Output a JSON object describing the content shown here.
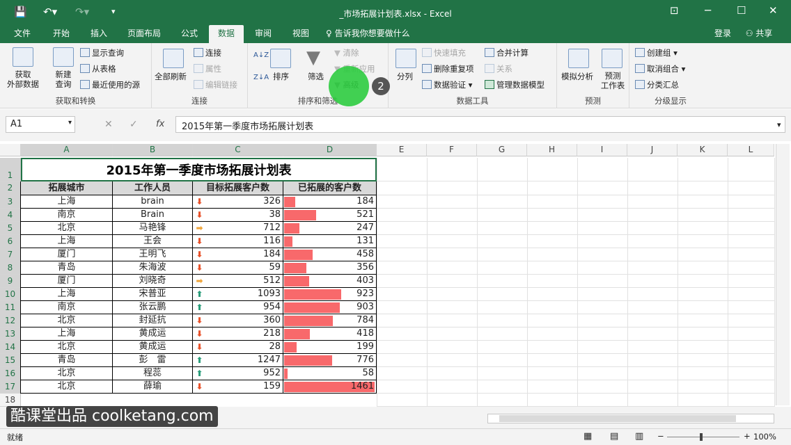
{
  "window": {
    "title": "_市场拓展计划表.xlsx - Excel"
  },
  "tabs": [
    "文件",
    "开始",
    "插入",
    "页面布局",
    "公式",
    "数据",
    "审阅",
    "视图"
  ],
  "tell_me": "告诉我你想要做什么",
  "account": {
    "login": "登录",
    "share": "共享"
  },
  "ribbon": {
    "get_transform": {
      "label": "获取和转换",
      "get_data": "获取\n外部数据",
      "new_query": "新建\n查询",
      "show_queries": "显示查询",
      "from_table": "从表格",
      "recent_sources": "最近使用的源"
    },
    "connections": {
      "label": "连接",
      "refresh_all": "全部刷新",
      "connections": "连接",
      "properties": "属性",
      "edit_links": "编辑链接"
    },
    "sort_filter": {
      "label": "排序和筛选",
      "sort": "排序",
      "filter": "筛选",
      "clear": "清除",
      "reapply": "重新应用",
      "advanced": "高级"
    },
    "data_tools": {
      "label": "数据工具",
      "split": "分列",
      "flash_fill": "快速填充",
      "remove_dup": "删除重复项",
      "validation": "数据验证",
      "consolidate": "合并计算",
      "relations": "关系",
      "data_model": "管理数据模型"
    },
    "forecast": {
      "label": "预测",
      "what_if": "模拟分析",
      "forecast_sheet": "预测\n工作表"
    },
    "outline": {
      "label": "分级显示",
      "group": "创建组",
      "ungroup": "取消组合",
      "subtotal": "分类汇总"
    }
  },
  "formula_bar": {
    "name_box": "A1",
    "content": "2015年第一季度市场拓展计划表"
  },
  "columns": [
    "A",
    "B",
    "C",
    "D",
    "E",
    "F",
    "G",
    "H",
    "I",
    "J",
    "K",
    "L"
  ],
  "sheet": {
    "title": "2015年第一季度市场拓展计划表",
    "headers": [
      "拓展城市",
      "工作人员",
      "目标拓展客户数",
      "已拓展的客户数"
    ],
    "rows": [
      {
        "city": "上海",
        "person": "brain",
        "target": "326",
        "done": "184",
        "arrow": "down",
        "bar": 0.126
      },
      {
        "city": "南京",
        "person": "Brain",
        "target": "38",
        "done": "521",
        "arrow": "down",
        "bar": 0.357
      },
      {
        "city": "北京",
        "person": "马艳锋",
        "target": "712",
        "done": "247",
        "arrow": "right",
        "bar": 0.169
      },
      {
        "city": "上海",
        "person": "王会",
        "target": "116",
        "done": "131",
        "arrow": "down",
        "bar": 0.09
      },
      {
        "city": "厦门",
        "person": "王明飞",
        "target": "184",
        "done": "458",
        "arrow": "down",
        "bar": 0.313
      },
      {
        "city": "青岛",
        "person": "朱海波",
        "target": "59",
        "done": "356",
        "arrow": "down",
        "bar": 0.244
      },
      {
        "city": "厦门",
        "person": "刘晓奇",
        "target": "512",
        "done": "403",
        "arrow": "right",
        "bar": 0.276
      },
      {
        "city": "上海",
        "person": "宋普亚",
        "target": "1093",
        "done": "923",
        "arrow": "up",
        "bar": 0.632
      },
      {
        "city": "南京",
        "person": "张云鹏",
        "target": "954",
        "done": "903",
        "arrow": "up",
        "bar": 0.618
      },
      {
        "city": "北京",
        "person": "封延抗",
        "target": "360",
        "done": "784",
        "arrow": "down",
        "bar": 0.537
      },
      {
        "city": "上海",
        "person": "黄成运",
        "target": "218",
        "done": "418",
        "arrow": "down",
        "bar": 0.286
      },
      {
        "city": "北京",
        "person": "黄成运",
        "target": "28",
        "done": "199",
        "arrow": "down",
        "bar": 0.136
      },
      {
        "city": "青岛",
        "person": "彭　雷",
        "target": "1247",
        "done": "776",
        "arrow": "up",
        "bar": 0.531
      },
      {
        "city": "北京",
        "person": "程蕊",
        "target": "952",
        "done": "58",
        "arrow": "up",
        "bar": 0.04
      },
      {
        "city": "北京",
        "person": "薛瑜",
        "target": "159",
        "done": "1461",
        "arrow": "down",
        "bar": 1.0
      }
    ]
  },
  "row_numbers": [
    "1",
    "2",
    "3",
    "4",
    "5",
    "6",
    "7",
    "8",
    "9",
    "10",
    "11",
    "12",
    "13",
    "14",
    "15",
    "16",
    "17",
    "18"
  ],
  "status": {
    "ready": "就绪",
    "zoom": "100%"
  },
  "watermark": "酷课堂出品 coolketang.com",
  "step_badge": "2",
  "colors": {
    "excel_green": "#217346",
    "bar": "#f8696b",
    "arrow_down": "#e8522a",
    "arrow_right": "#f0a53a",
    "arrow_up": "#2a9d7a"
  }
}
